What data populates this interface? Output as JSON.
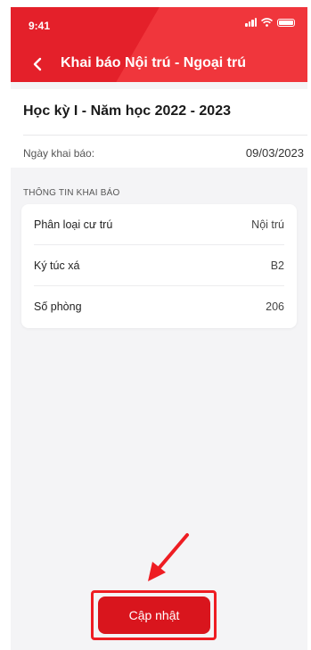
{
  "status_bar": {
    "time": "9:41"
  },
  "header": {
    "title": "Khai báo Nội trú - Ngoại trú",
    "back_icon": "chevron-left-icon"
  },
  "declaration": {
    "semester": "Học kỳ I - Năm học 2022  - 2023",
    "date_label": "Ngày khai báo:",
    "date_value": "09/03/2023"
  },
  "section_title": "THÔNG TIN KHAI BÁO",
  "info_rows": [
    {
      "label": "Phân loại cư trú",
      "value": "Nội trú"
    },
    {
      "label": "Ký túc xá",
      "value": "B2"
    },
    {
      "label": "Số phòng",
      "value": "206"
    }
  ],
  "update_button": {
    "label": "Cập nhật"
  },
  "colors": {
    "brand_red": "#e4202a",
    "button_red": "#d9151d",
    "annotation_red": "#ee1d23"
  },
  "annotation": {
    "arrow_icon": "pointer-arrow-icon"
  }
}
